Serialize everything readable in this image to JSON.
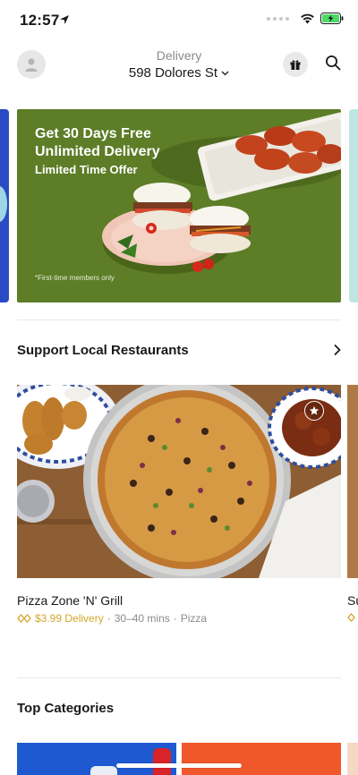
{
  "status_bar": {
    "time": "12:57",
    "icons": [
      "location-arrow-icon",
      "wifi-icon",
      "battery-charging-icon"
    ]
  },
  "header": {
    "mode_label": "Delivery",
    "address": "598 Dolores St",
    "icons": [
      "avatar-icon",
      "gift-icon",
      "search-icon",
      "chevron-down-icon"
    ]
  },
  "promo": {
    "title": "Get 30 Days Free Unlimited Delivery",
    "subtitle": "Limited Time Offer",
    "note": "*First-time members only",
    "background_color": "#5d7d27"
  },
  "section_local": {
    "title": "Support Local Restaurants",
    "arrow_icon": "chevron-right-icon"
  },
  "store": {
    "name": "Pizza Zone 'N' Grill",
    "delivery_fee": "$3.99 Delivery",
    "eta": "30–40 mins",
    "cuisine": "Pizza",
    "separator": "·",
    "fee_color": "#d3a62b",
    "badge_icon": "star-icon"
  },
  "store_peek": {
    "name": "Su"
  },
  "section_categories": {
    "title": "Top Categories"
  },
  "colors": {
    "accent": "#d3a62b",
    "muted_text": "#8a8a8a",
    "promo_green": "#5d7d27"
  }
}
